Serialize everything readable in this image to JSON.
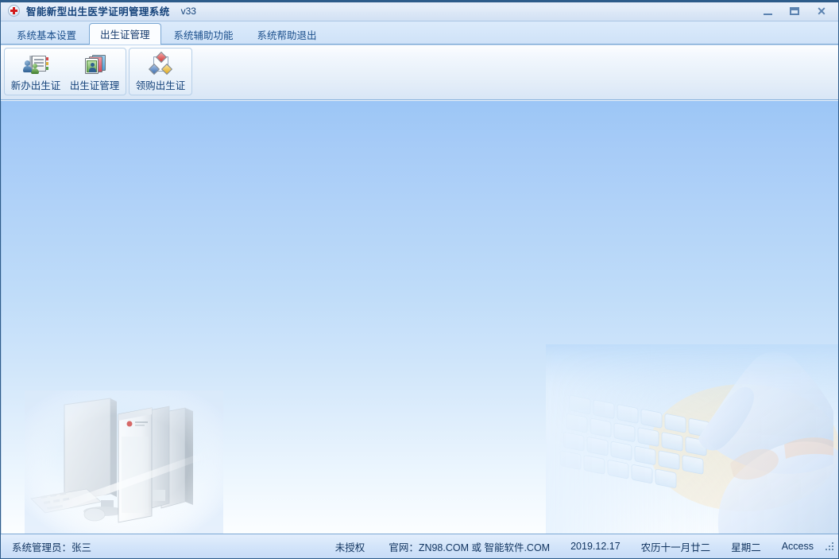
{
  "window": {
    "title": "智能新型出生医学证明管理系统",
    "version": "v33",
    "icon": "medical-cross-icon",
    "controls": {
      "minimize": "—",
      "maximize": "□",
      "close": "✕"
    }
  },
  "tabs": [
    {
      "label": "系统基本设置",
      "active": false
    },
    {
      "label": "出生证管理",
      "active": true
    },
    {
      "label": "系统辅助功能",
      "active": false
    },
    {
      "label": "系统帮助退出",
      "active": false
    }
  ],
  "ribbon": {
    "groups": [
      {
        "name": "birth-certificate-group",
        "buttons": [
          {
            "label": "新办出生证",
            "icon": "new-certificate-icon"
          },
          {
            "label": "出生证管理",
            "icon": "manage-certificates-icon"
          }
        ]
      },
      {
        "name": "purchase-group",
        "buttons": [
          {
            "label": "领购出生证",
            "icon": "purchase-certificate-icon"
          }
        ]
      }
    ]
  },
  "workspace": {
    "art": [
      {
        "name": "desktop-computer-illustration"
      },
      {
        "name": "hands-typing-keyboard-illustration"
      }
    ]
  },
  "statusbar": {
    "operator": "系统管理员：张三",
    "license": "未授权",
    "website": "官网：ZN98.COM 或 智能软件.COM",
    "date": "2019.12.17",
    "lunar_date": "农历十一月廿二",
    "weekday": "星期二",
    "database": "Access",
    "grip": "resize-grip-icon"
  },
  "colors": {
    "accent": "#2e5c8a",
    "title_text": "#14427a",
    "canvas_top": "#9cc6f6",
    "canvas_bottom": "#fcfeff",
    "cross_red": "#d21a1a"
  }
}
